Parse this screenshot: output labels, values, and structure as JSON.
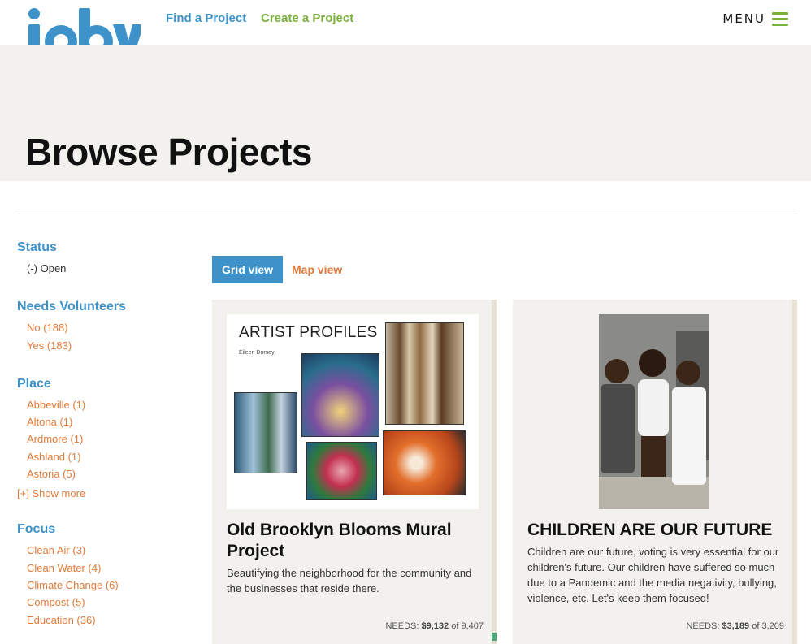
{
  "header": {
    "logo_text": "ioby",
    "nav": {
      "find": "Find a Project",
      "create": "Create a Project"
    },
    "menu_label": "MENU"
  },
  "hero": {
    "title": "Browse Projects"
  },
  "sidebar": {
    "status": {
      "title": "Status",
      "items": [
        "(-) Open"
      ]
    },
    "volunteers": {
      "title": "Needs Volunteers",
      "items": [
        "No (188)",
        "Yes (183)"
      ]
    },
    "place": {
      "title": "Place",
      "items": [
        "Abbeville (1)",
        "Altona (1)",
        "Ardmore (1)",
        "Ashland (1)",
        "Astoria (5)"
      ],
      "show_more": "[+] Show more"
    },
    "focus": {
      "title": "Focus",
      "items": [
        "Clean Air (3)",
        "Clean Water (4)",
        "Climate Change (6)",
        "Compost (5)",
        "Education (36)"
      ]
    }
  },
  "views": {
    "grid": "Grid view",
    "map": "Map view"
  },
  "cards": [
    {
      "title": "Old Brooklyn Blooms Mural Project",
      "description": "Beautifying the neighborhood for the community and the businesses that reside there.",
      "needs_label": "NEEDS:",
      "needs_amount": "$9,132",
      "needs_total": "of 9,407",
      "image": {
        "heading": "ARTIST PROFILES",
        "subheading": "Eileen Dorsey"
      }
    },
    {
      "title": "CHILDREN ARE OUR FUTURE",
      "description": "Children are our future, voting is very essential for our children's future. Our children have suffered so much due to a Pandemic and the media negativity, bullying, violence, etc. Let's keep them focused!",
      "needs_label": "NEEDS:",
      "needs_amount": "$3,189",
      "needs_total": "of 3,209"
    }
  ],
  "colors": {
    "brand_blue": "#3d93c9",
    "brand_green": "#7ab03e",
    "link_orange": "#e07b3a",
    "hero_bg": "#f3f1ed"
  }
}
